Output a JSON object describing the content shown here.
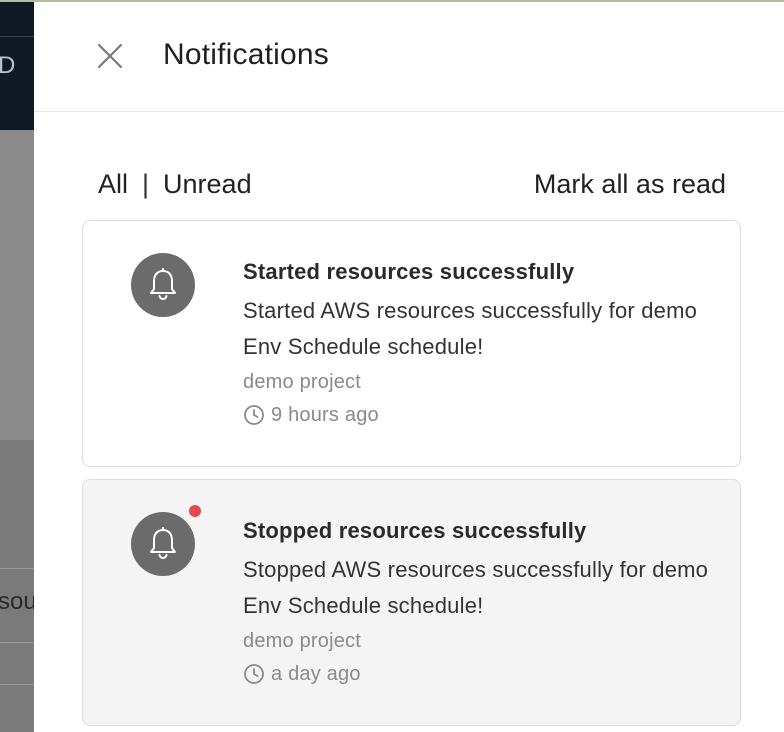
{
  "background": {
    "topbar_text": "D",
    "row_text": "sou"
  },
  "drawer": {
    "title": "Notifications",
    "close_icon": "close-icon",
    "filters": {
      "all_label": "All",
      "separator": "|",
      "unread_label": "Unread"
    },
    "mark_all_label": "Mark all as read",
    "notifications": [
      {
        "title": "Started resources successfully",
        "body": "Started AWS resources successfully for demo Env Schedule schedule!",
        "project": "demo project",
        "time": "9 hours ago",
        "unread": false,
        "icon": "bell-icon"
      },
      {
        "title": "Stopped resources successfully",
        "body": "Stopped AWS resources successfully for demo Env Schedule schedule!",
        "project": "demo project",
        "time": "a day ago",
        "unread": true,
        "icon": "bell-icon"
      }
    ]
  },
  "colors": {
    "unread_dot": "#e5484d",
    "bell_circle": "#6b6b6b",
    "unread_card_bg": "#f4f4f4"
  }
}
